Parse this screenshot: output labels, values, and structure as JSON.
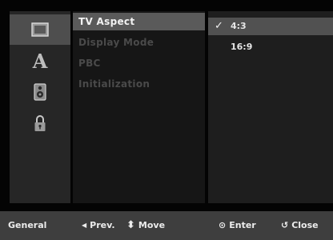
{
  "icons": [
    {
      "name": "general-icon",
      "selected": true
    },
    {
      "name": "language-icon",
      "glyph": "A"
    },
    {
      "name": "audio-speaker-icon"
    },
    {
      "name": "lock-icon"
    }
  ],
  "menu": {
    "items": [
      {
        "label": "TV Aspect",
        "selected": true
      },
      {
        "label": "Display Mode"
      },
      {
        "label": "PBC"
      },
      {
        "label": "Initialization"
      }
    ]
  },
  "options": {
    "check_glyph": "✓",
    "items": [
      {
        "label": "4:3",
        "selected": true
      },
      {
        "label": "16:9"
      }
    ]
  },
  "bottom": {
    "section": "General",
    "prev_glyph": "◀",
    "prev": "Prev.",
    "move_glyph": "⬍",
    "move": "Move",
    "enter_glyph": "⊙",
    "enter": "Enter",
    "close_glyph": "↺",
    "close": "Close"
  }
}
